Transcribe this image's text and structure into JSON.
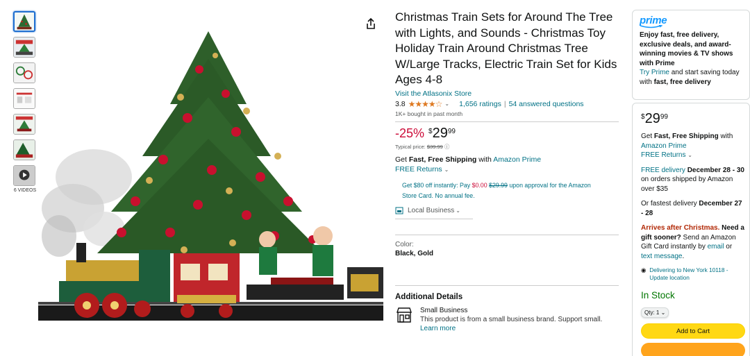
{
  "thumbnails": {
    "videos_label": "6 VIDEOS"
  },
  "product": {
    "title": "Christmas Train Sets for Around The Tree with Lights, and Sounds - Christmas Toy Holiday Train Around Christmas Tree W/Large Tracks, Electric Train Set for Kids Ages 4-8",
    "store_link": "Visit the Atlasonix Store",
    "rating_value": "3.8",
    "stars": "★★★★☆",
    "ratings_count": "1,656 ratings",
    "separator": "|",
    "answered": "54 answered questions",
    "bought": "1K+ bought in past month"
  },
  "price": {
    "discount": "-25%",
    "currency": "$",
    "whole": "29",
    "fraction": "99",
    "typical_label": "Typical price:",
    "typical_value": "$39.99"
  },
  "shipping": {
    "get": "Get ",
    "fast_free": "Fast, Free Shipping",
    "with": " with ",
    "prime_link": "Amazon Prime",
    "free_returns": "FREE Returns"
  },
  "promo": {
    "part1": "Get $80 off instantly: Pay ",
    "zero": "$0.00",
    "struck": "$29.99",
    "part2": " upon approval for the Amazon Store Card. No annual fee."
  },
  "local_business": "Local Business",
  "color": {
    "label": "Color:",
    "value": "Black, Gold"
  },
  "additional": {
    "heading": "Additional Details",
    "small_business": "Small Business",
    "desc": "This product is from a small business brand. Support small.",
    "learn_more": "Learn more"
  },
  "prime_box": {
    "logo": "prime",
    "text": "Enjoy fast, free delivery, exclusive deals, and award-winning movies & TV shows with Prime",
    "try": "Try Prime",
    "try_rest": " and start saving today with ",
    "try_bold": "fast, free delivery"
  },
  "buy_box": {
    "currency": "$",
    "whole": "29",
    "fraction": "99",
    "get": "Get ",
    "fast_free": "Fast, Free Shipping",
    "with": " with",
    "prime_link": "Amazon Prime",
    "free_returns": "FREE Returns",
    "free_delivery_link": "FREE delivery",
    "delivery_dates": "December 28 - 30",
    "delivery_rest": "on orders shipped by Amazon over $35",
    "fastest_label": "Or fastest delivery ",
    "fastest_dates": "December 27 - 28",
    "arrives": "Arrives after Christmas.",
    "gift_q": " Need a gift sooner?",
    "gift_rest1": " Send an Amazon Gift Card instantly by ",
    "email": "email",
    "or": " or ",
    "text_message": "text message",
    "period": ".",
    "delivering": "Delivering to New York 10118 - Update location",
    "in_stock": "In Stock",
    "qty": "Qty: 1",
    "add_to_cart": "Add to Cart"
  },
  "colors": {
    "link": "#007185",
    "discount": "#cc0c39",
    "stock": "#007600",
    "cart": "#ffd814",
    "star": "#de7921"
  }
}
